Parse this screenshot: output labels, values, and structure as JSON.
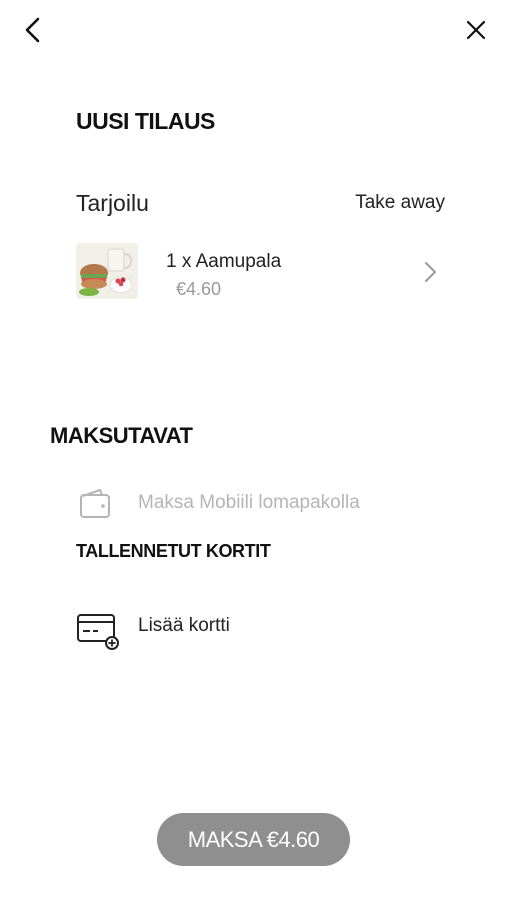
{
  "header": {
    "back_icon": "chevron-left-icon",
    "close_icon": "close-icon"
  },
  "order": {
    "title": "UUSI TILAUS",
    "serving_label": "Tarjoilu",
    "serving_value": "Take away",
    "item": {
      "name": "1 x Aamupala",
      "price": "€4.60",
      "image": "breakfast-photo",
      "chevron_icon": "chevron-right-icon"
    }
  },
  "payment": {
    "title": "MAKSUTAVAT",
    "wallet_label": "Maksa Mobiili lomapakolla",
    "wallet_icon": "wallet-icon",
    "saved_cards_title": "TALLENNETUT KORTIT",
    "add_card_label": "Lisää kortti",
    "add_card_icon": "card-add-icon"
  },
  "pay_button": {
    "label": "MAKSA €4.60",
    "color": "#8f8f8f"
  }
}
